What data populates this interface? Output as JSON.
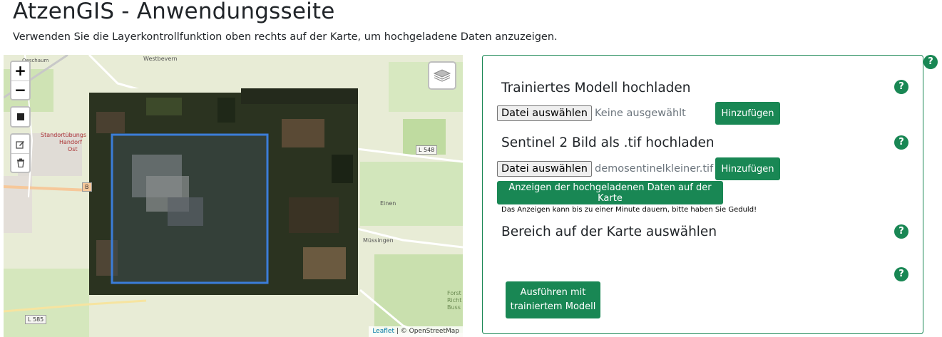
{
  "page": {
    "title": "AtzenGIS - Anwendungsseite",
    "subtitle": "Verwenden Sie die Layerkontrollfunktion oben rechts auf der Karte, um hochgeladene Daten anzuzeigen."
  },
  "map": {
    "zoom_in_label": "+",
    "zoom_out_label": "−",
    "attribution_link": "Leaflet",
    "attribution_text": "| © OpenStreetMap",
    "place_labels": {
      "westbevern": "Westbevern",
      "standortubungsplatz": "Standortübungs",
      "handorf": "Handorf",
      "ost": "Ost",
      "einen": "Einen",
      "mussingen": "Müssingen",
      "forst": "Forst",
      "richt": "Richt",
      "buss": "Buss",
      "oesch": "Oeschaum"
    },
    "road_tags": {
      "l548": "L 548",
      "l585": "L 585",
      "b": "B"
    },
    "colors": {
      "base": "#e9ecd9",
      "raster_dark": "#2b3320",
      "selection": "#3b7dd8"
    }
  },
  "panel": {
    "help_label": "?",
    "model_section": {
      "title": "Trainiertes Modell hochladen",
      "file_button": "Datei auswählen",
      "file_name": "Keine ausgewählt",
      "add_button": "Hinzufügen"
    },
    "sentinel_section": {
      "title": "Sentinel 2 Bild als .tif hochladen",
      "file_button": "Datei auswählen",
      "file_name": "demosentinelkleiner.tif",
      "add_button": "Hinzufügen",
      "show_button": "Anzeigen der hochgeladenen Daten auf der Karte",
      "note": "Das Anzeigen kann bis zu einer Minute dauern, bitte haben Sie Geduld!"
    },
    "area_section": {
      "title": "Bereich auf der Karte auswählen"
    },
    "run_button_line1": "Ausführen mit",
    "run_button_line2": "trainiertem Modell"
  },
  "colors": {
    "accent": "#198754"
  }
}
